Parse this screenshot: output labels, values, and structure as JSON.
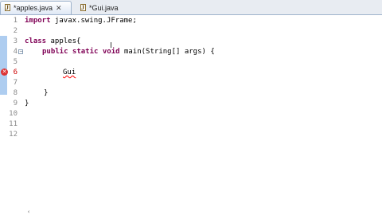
{
  "tabs": [
    {
      "label": "*apples.java",
      "close": "✕",
      "active": true
    },
    {
      "label": "*Gui.java",
      "active": false
    }
  ],
  "line_numbers": [
    "1",
    "2",
    "3",
    "4",
    "5",
    "6",
    "7",
    "8",
    "9",
    "10",
    "11",
    "12"
  ],
  "code": {
    "l1": [
      "import",
      " javax.swing.JFrame;"
    ],
    "l3": [
      "class",
      " apples{"
    ],
    "l4": [
      "public static void",
      " main(String[] args) {"
    ],
    "l6": "Gui",
    "l8": "}",
    "l9": "}"
  },
  "fold_markers": [
    "−",
    "−"
  ],
  "error_marker": "✕",
  "text_cursor": "I",
  "bottom_marker": "‹"
}
